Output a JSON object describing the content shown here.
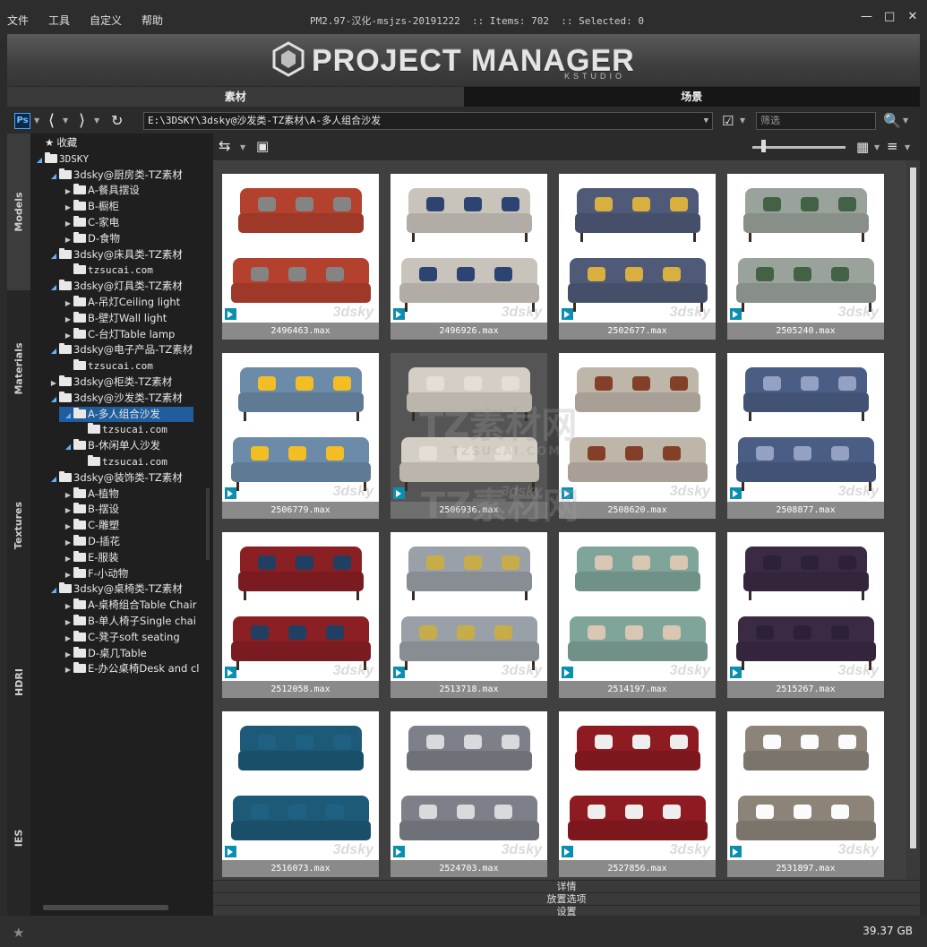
{
  "menu": [
    "文件",
    "工具",
    "自定义",
    "帮助"
  ],
  "window_title": "PM2.97-汉化-msjzs-20191222  :: Items: 702  :: Selected: 0",
  "banner": {
    "title": "PROJECT MANAGER",
    "subtitle": "KSTUDIO"
  },
  "tabs": {
    "assets": "素材",
    "scenes": "场景"
  },
  "toolbar": {
    "ps_label": "Ps",
    "path": "E:\\3DSKY\\3dsky@沙发类-TZ素材\\A-多人组合沙发",
    "filter_placeholder": "筛选"
  },
  "side_tabs": [
    "Models",
    "Materials",
    "Textures",
    "HDRI",
    "IES"
  ],
  "tree": [
    {
      "label": "收藏",
      "indent": 0,
      "tri": "",
      "icon": "star"
    },
    {
      "label": "3DSKY",
      "indent": 0,
      "tri": "open",
      "icon": "folder"
    },
    {
      "label": "3dsky@厨房类-TZ素材",
      "indent": 1,
      "tri": "open",
      "icon": "folder"
    },
    {
      "label": "A-餐具摆设",
      "indent": 2,
      "tri": "closed",
      "icon": "folder"
    },
    {
      "label": "B-橱柜",
      "indent": 2,
      "tri": "closed",
      "icon": "folder"
    },
    {
      "label": "C-家电",
      "indent": 2,
      "tri": "closed",
      "icon": "folder"
    },
    {
      "label": "D-食物",
      "indent": 2,
      "tri": "closed",
      "icon": "folder"
    },
    {
      "label": "3dsky@床具类-TZ素材",
      "indent": 1,
      "tri": "open",
      "icon": "folder"
    },
    {
      "label": "tzsucai.com",
      "indent": 2,
      "tri": "",
      "icon": "folder"
    },
    {
      "label": "3dsky@灯具类-TZ素材",
      "indent": 1,
      "tri": "open",
      "icon": "folder"
    },
    {
      "label": "A-吊灯Ceiling light",
      "indent": 2,
      "tri": "closed",
      "icon": "folder"
    },
    {
      "label": "B-壁灯Wall light",
      "indent": 2,
      "tri": "closed",
      "icon": "folder"
    },
    {
      "label": "C-台灯Table lamp",
      "indent": 2,
      "tri": "closed",
      "icon": "folder"
    },
    {
      "label": "3dsky@电子产品-TZ素材",
      "indent": 1,
      "tri": "open",
      "icon": "folder"
    },
    {
      "label": "tzsucai.com",
      "indent": 2,
      "tri": "",
      "icon": "folder"
    },
    {
      "label": "3dsky@柜类-TZ素材",
      "indent": 1,
      "tri": "closed",
      "icon": "folder"
    },
    {
      "label": "3dsky@沙发类-TZ素材",
      "indent": 1,
      "tri": "open",
      "icon": "folder"
    },
    {
      "label": "A-多人组合沙发",
      "indent": 2,
      "tri": "open",
      "icon": "folder",
      "selected": true
    },
    {
      "label": "tzsucai.com",
      "indent": 3,
      "tri": "",
      "icon": "folder"
    },
    {
      "label": "B-休闲单人沙发",
      "indent": 2,
      "tri": "open",
      "icon": "folder"
    },
    {
      "label": "tzsucai.com",
      "indent": 3,
      "tri": "",
      "icon": "folder"
    },
    {
      "label": "3dsky@装饰类-TZ素材",
      "indent": 1,
      "tri": "open",
      "icon": "folder"
    },
    {
      "label": "A-植物",
      "indent": 2,
      "tri": "closed",
      "icon": "folder"
    },
    {
      "label": "B-摆设",
      "indent": 2,
      "tri": "closed",
      "icon": "folder"
    },
    {
      "label": "C-雕塑",
      "indent": 2,
      "tri": "closed",
      "icon": "folder"
    },
    {
      "label": "D-插花",
      "indent": 2,
      "tri": "closed",
      "icon": "folder"
    },
    {
      "label": "E-服装",
      "indent": 2,
      "tri": "closed",
      "icon": "folder"
    },
    {
      "label": "F-小动物",
      "indent": 2,
      "tri": "closed",
      "icon": "folder"
    },
    {
      "label": "3dsky@桌椅类-TZ素材",
      "indent": 1,
      "tri": "open",
      "icon": "folder"
    },
    {
      "label": "A-桌椅组合Table Chair",
      "indent": 2,
      "tri": "closed",
      "icon": "folder"
    },
    {
      "label": "B-单人椅子Single chai",
      "indent": 2,
      "tri": "closed",
      "icon": "folder"
    },
    {
      "label": "C-凳子soft seating",
      "indent": 2,
      "tri": "closed",
      "icon": "folder"
    },
    {
      "label": "D-桌几Table",
      "indent": 2,
      "tri": "closed",
      "icon": "folder"
    },
    {
      "label": "E-办公桌椅Desk and cl",
      "indent": 2,
      "tri": "closed",
      "icon": "folder"
    }
  ],
  "items": [
    {
      "file": "2496463.max",
      "color": "#b4402e",
      "pillow": "#7a7a7a",
      "legs": false
    },
    {
      "file": "2496926.max",
      "color": "#c9c4bb",
      "pillow": "#2a3f6a",
      "legs": true
    },
    {
      "file": "2502677.max",
      "color": "#4e5a78",
      "pillow": "#c9a23a",
      "legs": true
    },
    {
      "file": "2505240.max",
      "color": "#9aa39b",
      "pillow": "#3d5a40",
      "legs": true
    },
    {
      "file": "2506779.max",
      "color": "#6b8ba8",
      "pillow": "#e0b020",
      "legs": true
    },
    {
      "file": "2506936.max",
      "color": "#d4cec4",
      "pillow": "#d4cec4",
      "legs": true,
      "hover": true
    },
    {
      "file": "2508620.max",
      "color": "#bfb6aa",
      "pillow": "#7a3a26",
      "legs": false
    },
    {
      "file": "2508877.max",
      "color": "#4a5d84",
      "pillow": "#8a95b5",
      "legs": true
    },
    {
      "file": "2512058.max",
      "color": "#8a1f24",
      "pillow": "#1f3a5c",
      "legs": true
    },
    {
      "file": "2513718.max",
      "color": "#9aa0a8",
      "pillow": "#b8a044",
      "legs": true
    },
    {
      "file": "2514197.max",
      "color": "#7fa59a",
      "pillow": "#c9b7a6",
      "legs": false
    },
    {
      "file": "2515267.max",
      "color": "#3a2a44",
      "pillow": "#2a1f33",
      "legs": true
    },
    {
      "file": "2516073.max",
      "color": "#1d5a78",
      "pillow": "#1d5a78",
      "legs": false
    },
    {
      "file": "2524703.max",
      "color": "#7d8088",
      "pillow": "#c8cacc",
      "legs": false
    },
    {
      "file": "2527856.max",
      "color": "#8e1a22",
      "pillow": "#dcdcdc",
      "legs": false
    },
    {
      "file": "2531897.max",
      "color": "#8c8478",
      "pillow": "#e8e8e8",
      "legs": false
    }
  ],
  "watermarks": {
    "brand_cn": "TZ素材网",
    "brand_url": "TZSUCAI.COM",
    "sky": "3dsky"
  },
  "panels": [
    "详情",
    "放置选项",
    "设置"
  ],
  "status": {
    "disk_space": "39.37 GB"
  },
  "colors": {
    "accent": "#1f5d9c",
    "tree_arrow": "#5fb3ff",
    "max_badge": "#0a8fb0"
  }
}
